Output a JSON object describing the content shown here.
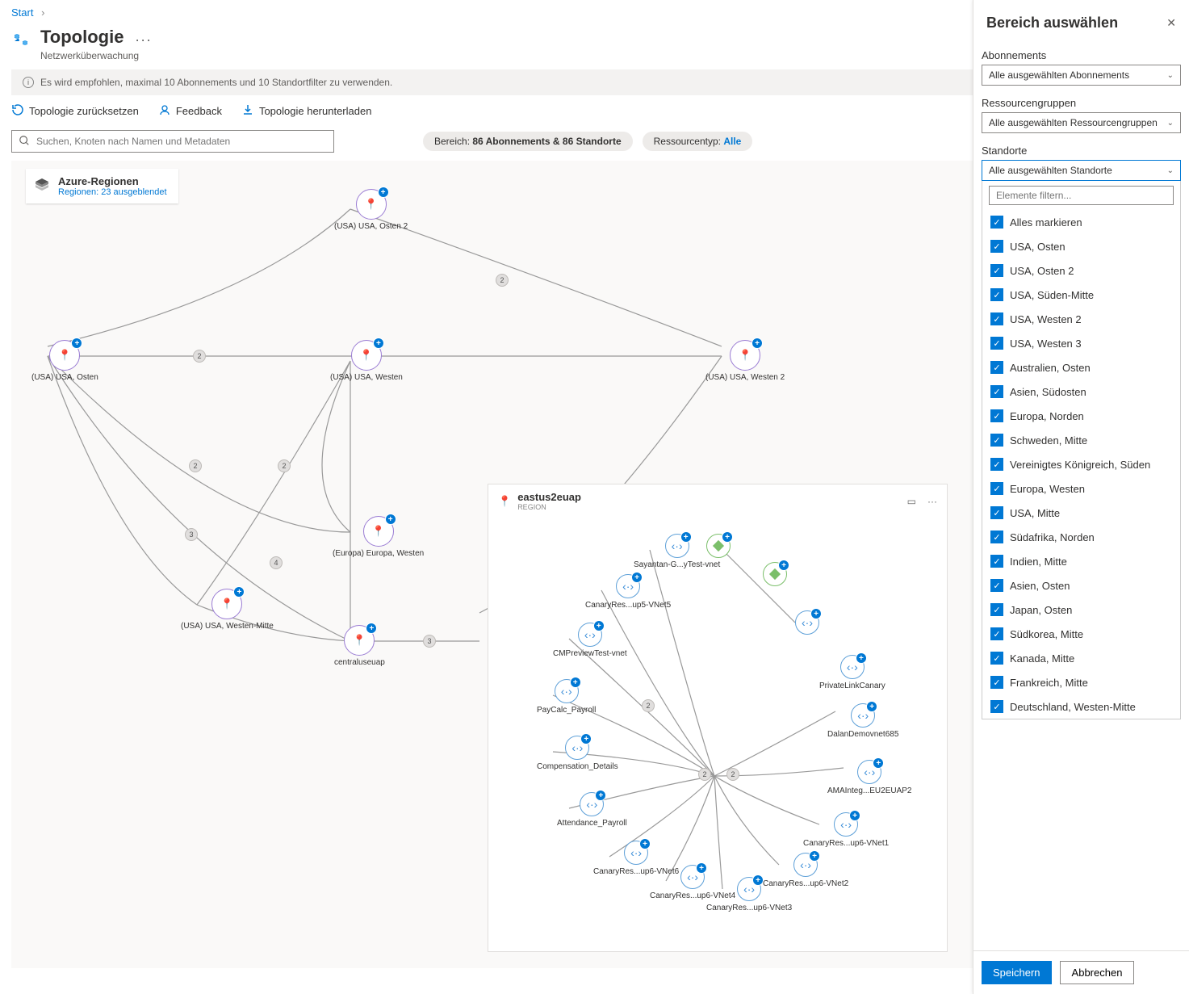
{
  "breadcrumb": {
    "start": "Start"
  },
  "header": {
    "title": "Topologie",
    "subtitle": "Netzwerküberwachung"
  },
  "info_bar": "Es wird empfohlen, maximal 10 Abonnements und 10 Standortfilter zu verwenden.",
  "toolbar": {
    "reset": "Topologie zurücksetzen",
    "feedback": "Feedback",
    "download": "Topologie herunterladen"
  },
  "search": {
    "placeholder": "Suchen, Knoten nach Namen und Metadaten"
  },
  "scope_pill": {
    "prefix": "Bereich: ",
    "value": "86 Abonnements & 86 Standorte"
  },
  "restype_pill": {
    "prefix": "Ressourcentyp: ",
    "value": "Alle"
  },
  "layers": {
    "title": "Azure-Regionen",
    "sub": "Regionen: 23 ausgeblendet"
  },
  "nodes": {
    "eastus2": "(USA) USA, Osten 2",
    "eastus": "(USA) USA, Osten",
    "westus": "(USA) USA, Westen",
    "westus2": "(USA) USA, Westen 2",
    "westeurope": "(Europa) Europa, Westen",
    "westcentralus": "(USA) USA, Westen-Mitte",
    "centraluseuap": "centraluseuap"
  },
  "edge_counts": {
    "b1": "2",
    "b2": "2",
    "b3": "2",
    "b4": "3",
    "b5": "2",
    "b6": "4",
    "b7": "3"
  },
  "detail": {
    "title": "eastus2euap",
    "subtitle": "REGION",
    "vnets": {
      "n1": "Sayantan-G...yTest-vnet",
      "n2": "CanaryRes...up5-VNet5",
      "n3": "CMPreviewTest-vnet",
      "n4": "PayCalc_Payroll",
      "n5": "Compensation_Details",
      "n6": "Attendance_Payroll",
      "n7": "CanaryRes...up6-VNet6",
      "n8": "CanaryRes...up6-VNet4",
      "n9": "CanaryRes...up6-VNet3",
      "n10": "CanaryRes...up6-VNet2",
      "n11": "CanaryRes...up6-VNet1",
      "n12": "AMAInteg...EU2EUAP2",
      "n13": "DalanDemovnet685",
      "n14": "PrivateLinkCanary"
    },
    "edge_counts": {
      "c1": "2",
      "c2": "2",
      "c3": "2"
    }
  },
  "panel": {
    "title": "Bereich auswählen",
    "subs_label": "Abonnements",
    "subs_value": "Alle ausgewählten Abonnements",
    "rg_label": "Ressourcengruppen",
    "rg_value": "Alle ausgewählten Ressourcengruppen",
    "loc_label": "Standorte",
    "loc_value": "Alle ausgewählten Standorte",
    "filter_placeholder": "Elemente filtern...",
    "select_all": "Alles markieren",
    "locations": [
      "USA, Osten",
      "USA, Osten 2",
      "USA, Süden-Mitte",
      "USA, Westen 2",
      "USA, Westen 3",
      "Australien, Osten",
      "Asien, Südosten",
      "Europa, Norden",
      "Schweden, Mitte",
      "Vereinigtes Königreich, Süden",
      "Europa, Westen",
      "USA, Mitte",
      "Südafrika, Norden",
      "Indien, Mitte",
      "Asien, Osten",
      "Japan, Osten",
      "Südkorea, Mitte",
      "Kanada, Mitte",
      "Frankreich, Mitte",
      "Deutschland, Westen-Mitte"
    ],
    "save": "Speichern",
    "cancel": "Abbrechen"
  }
}
